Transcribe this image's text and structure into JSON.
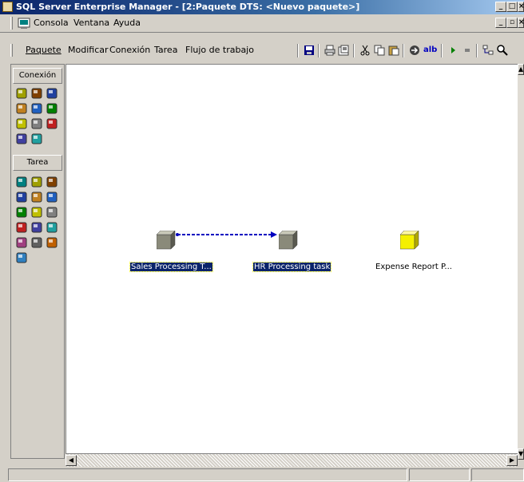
{
  "window": {
    "title": "SQL Server Enterprise Manager - [2:Paquete DTS: <Nuevo paquete>]",
    "buttons": [
      "_",
      "□",
      "×"
    ]
  },
  "menubar": {
    "items": [
      "Consola",
      "Ventana",
      "Ayuda"
    ],
    "doc_buttons": [
      "_",
      "▫",
      "×"
    ]
  },
  "package_menu": {
    "items": [
      "Paquete",
      "Modificar",
      "Conexión",
      "Tarea",
      "Flujo de trabajo"
    ]
  },
  "toolbar": {
    "icons": [
      "save-icon",
      "print-icon",
      "properties-icon",
      "cut-icon",
      "copy-icon",
      "paste-icon",
      "connect-icon",
      "text-annotation-icon",
      "run-icon",
      "stop-icon",
      "layout-icon",
      "zoom-icon"
    ],
    "text_annotation_label": "alb"
  },
  "palette": {
    "connection_header": "Conexión",
    "task_header": "Tarea",
    "connection_icons": [
      "sql-server-icon",
      "access-icon",
      "excel-icon",
      "dbase-icon",
      "html-file-icon",
      "oracle-icon",
      "paradox-icon",
      "text-dest-icon",
      "text-source-icon",
      "odbc-icon",
      "udl-icon"
    ],
    "task_icons": [
      "ftp-task-icon",
      "activex-script-icon",
      "transfer-objects-icon",
      "data-driven-query-icon",
      "execute-sql-icon",
      "bulk-insert-icon",
      "execute-package-icon",
      "message-queue-icon",
      "send-mail-icon",
      "analysis-services-icon",
      "data-mining-icon",
      "dynamic-properties-icon",
      "transfer-db-icon",
      "transfer-logins-icon",
      "transfer-jobs-icon",
      "custom-task-icon"
    ]
  },
  "canvas": {
    "tasks": [
      {
        "label": "Sales Processing T...",
        "color": "#8a8a7a",
        "selected": true
      },
      {
        "label": "HR Processing task",
        "color": "#8a8a7a",
        "selected": true
      },
      {
        "label": "Expense Report P...",
        "color": "#f4f000",
        "selected": false
      }
    ],
    "workflow": {
      "from": "Sales Processing T...",
      "to": "HR Processing task",
      "color": "#0000c0"
    }
  },
  "colors": {
    "titlebar_start": "#0a246a",
    "titlebar_end": "#a6caf0",
    "selection": "#0a246a",
    "face": "#d4d0c8"
  }
}
